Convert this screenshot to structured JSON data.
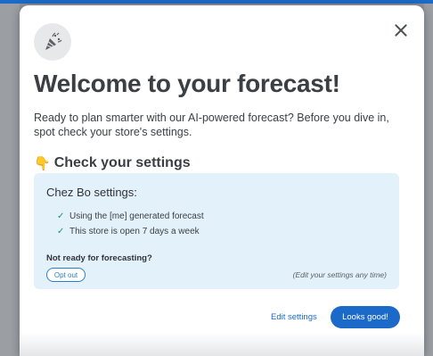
{
  "modal": {
    "title": "Welcome to your forecast!",
    "intro": "Ready to plan smarter with our AI-powered forecast? Before you dive in, spot check your store's settings.",
    "section_title": "Check your settings",
    "section_icon": "pointing-down-hand-icon",
    "header_icon": "party-popper-icon",
    "close_icon": "close-icon"
  },
  "settings": {
    "store_label": "Chez Bo settings:",
    "items": [
      "Using the [me] generated forecast",
      "This store is open 7 days a week"
    ],
    "not_ready_label": "Not ready for forecasting?",
    "opt_out_label": "Opt out",
    "edit_note": "(Edit your settings any time)"
  },
  "actions": {
    "edit_settings_label": "Edit settings",
    "looks_good_label": "Looks good!"
  },
  "colors": {
    "accent": "#1b6ac9",
    "card_background": "#e3f1fb",
    "check": "#1f8f6d"
  }
}
